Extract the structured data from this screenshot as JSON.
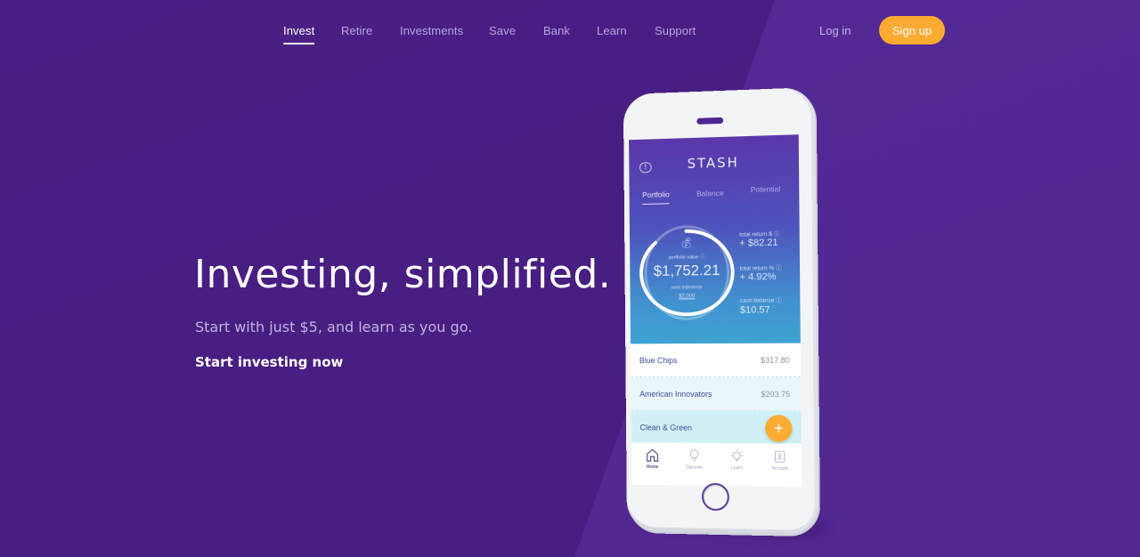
{
  "nav": {
    "items": [
      {
        "label": "Invest",
        "active": true
      },
      {
        "label": "Retire",
        "active": false
      },
      {
        "label": "Investments",
        "active": false
      },
      {
        "label": "Save",
        "active": false
      },
      {
        "label": "Bank",
        "active": false
      },
      {
        "label": "Learn",
        "active": false
      },
      {
        "label": "Support",
        "active": false
      }
    ],
    "login_label": "Log in",
    "signup_label": "Sign up"
  },
  "hero": {
    "title": "Investing, simplified.",
    "subtitle": "Start with just $5, and learn as you go.",
    "cta_label": "Start investing now"
  },
  "colors": {
    "background": "#4a1f85",
    "background_light": "#552a97",
    "accent": "#fbab32"
  },
  "phone": {
    "app_name": "STASH",
    "feedback_icon": "speech-bubble-exclamation-icon",
    "tabs": [
      {
        "label": "Portfolio",
        "active": true
      },
      {
        "label": "Balance",
        "active": false
      },
      {
        "label": "Potential",
        "active": false
      }
    ],
    "portfolio": {
      "icon": "money-bag-icon",
      "value_label": "portfolio value ⓘ",
      "value": "$1,752.21",
      "milestone_label": "next milestone",
      "milestone_value": "$2,000",
      "milestone_progress": 0.876
    },
    "stats": [
      {
        "label": "total return $ ⓘ",
        "value": "+ $82.21"
      },
      {
        "label": "total return % ⓘ",
        "value": "+ 4.92%"
      },
      {
        "label": "cash balance ⓘ",
        "value": "$10.57"
      }
    ],
    "holdings": [
      {
        "name": "Blue Chips",
        "amount": "$317.80",
        "bg": "#ffffff"
      },
      {
        "name": "American Innovators",
        "amount": "$203.75",
        "bg": "#e9f7fa"
      },
      {
        "name": "Clean & Green",
        "amount": "",
        "bg": "#cff1f5"
      }
    ],
    "fab_label": "+",
    "tabbar": [
      {
        "label": "Home",
        "icon": "home-icon",
        "active": true
      },
      {
        "label": "Discover",
        "icon": "lightbulb-globe-icon",
        "active": false
      },
      {
        "label": "Learn",
        "icon": "lightbulb-icon",
        "active": false
      },
      {
        "label": "Account",
        "icon": "id-badge-icon",
        "active": false
      }
    ]
  }
}
